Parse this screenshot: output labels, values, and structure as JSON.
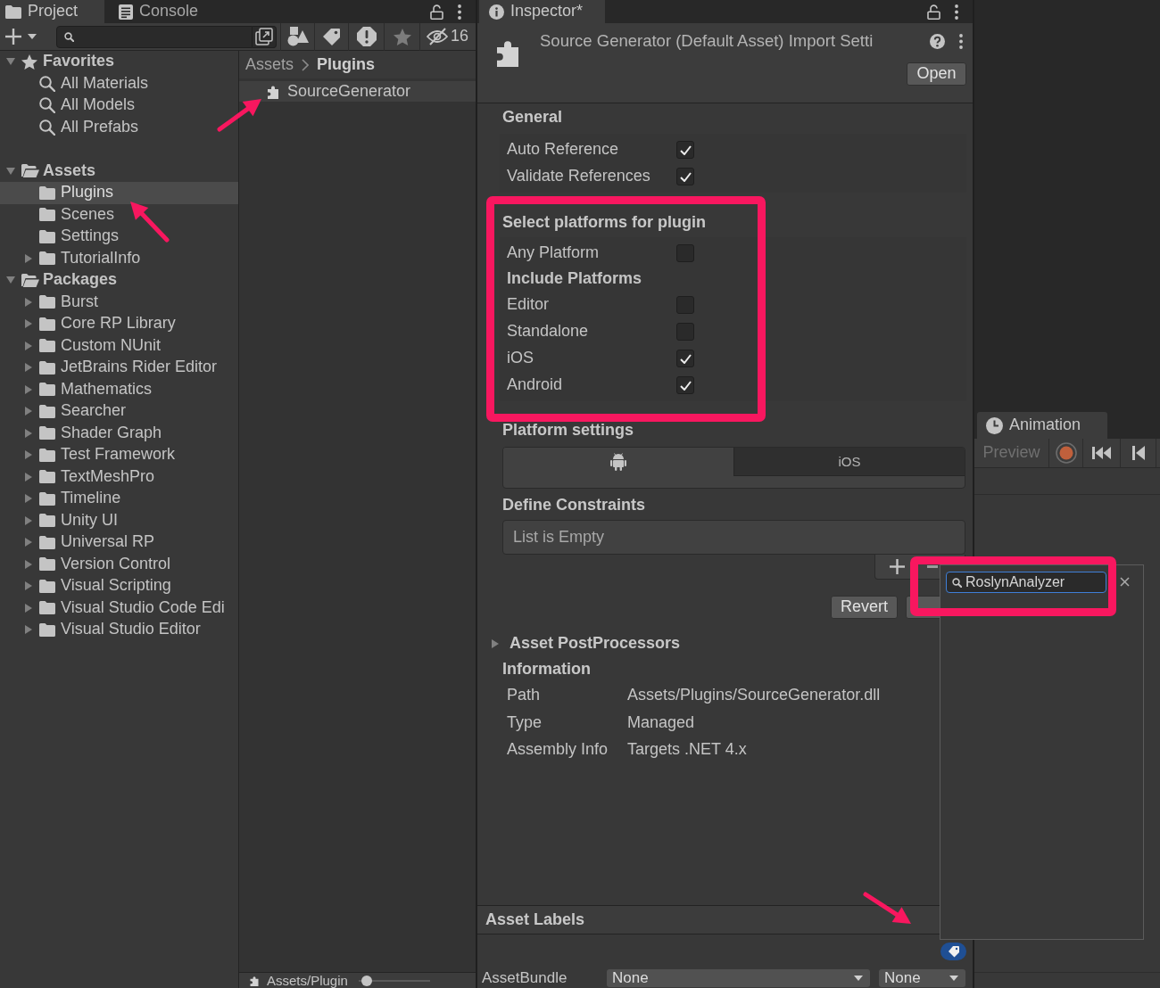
{
  "project": {
    "tabs": [
      {
        "kind": "project",
        "label": "Project",
        "selected": true
      },
      {
        "kind": "console",
        "label": "Console",
        "selected": false
      }
    ],
    "hidden_count": "16",
    "tree": [
      {
        "kind": "favorites",
        "label": "Favorites",
        "expanded": true,
        "selected": false,
        "children": [
          {
            "kind": "search",
            "label": "All Materials",
            "selected": false
          },
          {
            "kind": "search",
            "label": "All Models",
            "selected": false
          },
          {
            "kind": "search",
            "label": "All Prefabs",
            "selected": false
          }
        ]
      },
      {
        "kind": "folder",
        "label": "Assets",
        "expanded": true,
        "selected": false,
        "children": [
          {
            "kind": "folder",
            "label": "Plugins",
            "selected": true
          },
          {
            "kind": "folder",
            "label": "Scenes",
            "selected": false
          },
          {
            "kind": "folder",
            "label": "Settings",
            "selected": false
          },
          {
            "kind": "folder",
            "label": "TutorialInfo",
            "expanded": false,
            "selected": false
          }
        ]
      },
      {
        "kind": "folder",
        "label": "Packages",
        "expanded": true,
        "selected": false,
        "children": [
          {
            "kind": "folder",
            "label": "Burst",
            "expanded": false,
            "selected": false
          },
          {
            "kind": "folder",
            "label": "Core RP Library",
            "expanded": false,
            "selected": false
          },
          {
            "kind": "folder",
            "label": "Custom NUnit",
            "expanded": false,
            "selected": false
          },
          {
            "kind": "folder",
            "label": "JetBrains Rider Editor",
            "expanded": false,
            "selected": false
          },
          {
            "kind": "folder",
            "label": "Mathematics",
            "expanded": false,
            "selected": false
          },
          {
            "kind": "folder",
            "label": "Searcher",
            "expanded": false,
            "selected": false
          },
          {
            "kind": "folder",
            "label": "Shader Graph",
            "expanded": false,
            "selected": false
          },
          {
            "kind": "folder",
            "label": "Test Framework",
            "expanded": false,
            "selected": false
          },
          {
            "kind": "folder",
            "label": "TextMeshPro",
            "expanded": false,
            "selected": false
          },
          {
            "kind": "folder",
            "label": "Timeline",
            "expanded": false,
            "selected": false
          },
          {
            "kind": "folder",
            "label": "Unity UI",
            "expanded": false,
            "selected": false
          },
          {
            "kind": "folder",
            "label": "Universal RP",
            "expanded": false,
            "selected": false
          },
          {
            "kind": "folder",
            "label": "Version Control",
            "expanded": false,
            "selected": false
          },
          {
            "kind": "folder",
            "label": "Visual Scripting",
            "expanded": false,
            "selected": false
          },
          {
            "kind": "folder",
            "label": "Visual Studio Code Edi",
            "expanded": false,
            "selected": false
          },
          {
            "kind": "folder",
            "label": "Visual Studio Editor",
            "expanded": false,
            "selected": false
          }
        ]
      }
    ],
    "breadcrumb": [
      {
        "label": "Assets"
      },
      {
        "label": "Plugins"
      }
    ],
    "files": [
      {
        "label": "SourceGenerator",
        "selected": true
      }
    ],
    "footer_path": "Assets/Plugin",
    "zoom_slider": {
      "level": 0.05
    }
  },
  "inspector": {
    "tab": {
      "label": "Inspector*",
      "selected": true
    },
    "title": "Source Generator (Default Asset) Import Setti",
    "open_button": "Open",
    "sections": [
      {
        "title": "General",
        "rows": [
          {
            "kind": "checkbox",
            "label": "Auto Reference",
            "checked": true
          },
          {
            "kind": "checkbox",
            "label": "Validate References",
            "checked": true
          }
        ]
      },
      {
        "title": "Select platforms for plugin",
        "rows": [
          {
            "kind": "checkbox",
            "label": "Any Platform",
            "checked": false
          },
          {
            "kind": "heading",
            "label": "Include Platforms"
          },
          {
            "kind": "checkbox",
            "label": "Editor",
            "checked": false
          },
          {
            "kind": "checkbox",
            "label": "Standalone",
            "checked": false
          },
          {
            "kind": "checkbox",
            "label": "iOS",
            "checked": true
          },
          {
            "kind": "checkbox",
            "label": "Android",
            "checked": true
          }
        ]
      }
    ],
    "platform_settings": {
      "title": "Platform settings",
      "tabs": [
        {
          "kind": "icon",
          "selected": true
        },
        {
          "kind": "text",
          "label": "iOS",
          "selected": false
        }
      ]
    },
    "define_constraints": {
      "title": "Define Constraints",
      "empty_text": "List is Empty"
    },
    "revert_button": "Revert",
    "post_processors": {
      "label": "Asset PostProcessors",
      "expanded": false
    },
    "information": {
      "title": "Information",
      "rows": [
        {
          "label": "Path",
          "value": "Assets/Plugins/SourceGenerator.dll"
        },
        {
          "label": "Type",
          "value": "Managed"
        },
        {
          "label": "Assembly Info",
          "value": "Targets .NET 4.x"
        }
      ]
    },
    "asset_labels": {
      "title": "Asset Labels"
    },
    "asset_bundle": {
      "label": "AssetBundle",
      "name": "None",
      "variant": "None"
    }
  },
  "animation": {
    "tab": {
      "label": "Animation",
      "selected": true
    },
    "preview": {
      "label": "Preview",
      "disabled": true
    }
  },
  "label_popup": {
    "search_value": "RoslynAnalyzer"
  }
}
